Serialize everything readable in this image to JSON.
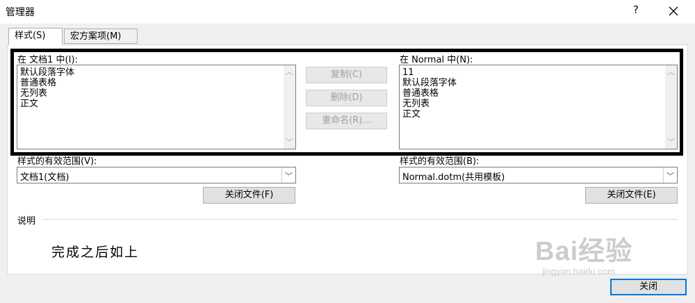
{
  "window": {
    "title": "管理器",
    "help": "?"
  },
  "tabs": [
    {
      "label": "样式(S)"
    },
    {
      "label": "宏方案项(M)"
    }
  ],
  "left": {
    "in_label": "在 文档1 中(I):",
    "items": [
      "默认段落字体",
      "普通表格",
      "无列表",
      "正文"
    ],
    "scope_label": "样式的有效范围(V):",
    "scope_value": "文档1(文档)",
    "close_file": "关闭文件(F)"
  },
  "right": {
    "in_label": "在 Normal 中(N):",
    "items": [
      "11",
      "默认段落字体",
      "普通表格",
      "无列表",
      "正文"
    ],
    "scope_label": "样式的有效范围(B):",
    "scope_value": "Normal.dotm(共用模板)",
    "close_file": "关闭文件(E)"
  },
  "actions": {
    "copy": "复制(C)",
    "delete": "删除(D)",
    "rename": "重命名(R)..."
  },
  "description": {
    "label": "说明",
    "text": "完成之后如上"
  },
  "footer": {
    "close": "关闭"
  },
  "watermark": {
    "brand": "Bai经验",
    "url": "jingyan.baidu.com"
  },
  "colors": {
    "default_button_border": "#0078d7",
    "highlight_box": "#000000"
  }
}
